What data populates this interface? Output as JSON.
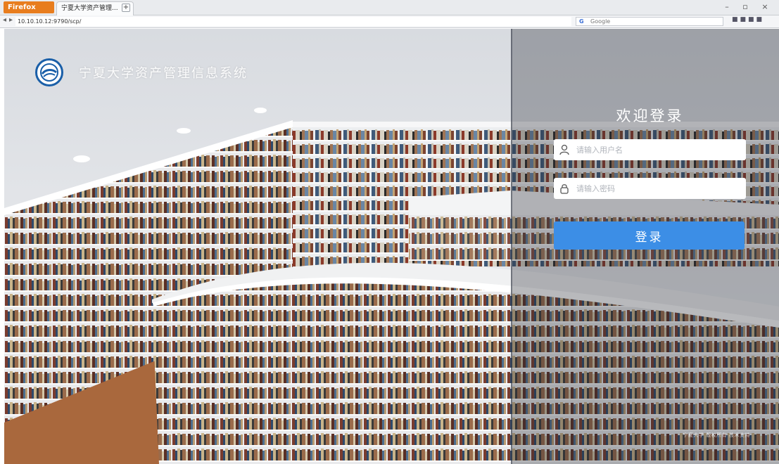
{
  "browser": {
    "menu_label": "Firefox",
    "tab_title": "宁夏大学资产管理...",
    "new_tab": "+",
    "url": "10.10.10.12:9790/scp/",
    "search_placeholder": "Google",
    "search_engine_glyph": "G",
    "window_controls": [
      "–",
      "▫",
      "×"
    ]
  },
  "brand": {
    "system_name": "宁夏大学资产管理信息系统"
  },
  "login": {
    "welcome": "欢迎登录",
    "username_placeholder": "请输入用户名",
    "password_placeholder": "请输入密码",
    "submit_label": "登录"
  },
  "footer": {
    "text": "宁夏大学 版权所有 技术支持"
  },
  "colors": {
    "accent": "#3c8ee6",
    "brand_blue": "#1a5fa8",
    "firefox_orange": "#e87d1e"
  }
}
